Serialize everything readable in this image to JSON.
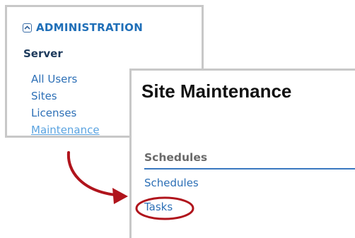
{
  "admin": {
    "title": "ADMINISTRATION",
    "section": "Server",
    "links": [
      {
        "label": "All Users"
      },
      {
        "label": "Sites"
      },
      {
        "label": "Licenses"
      },
      {
        "label": "Maintenance"
      }
    ],
    "active_link": "Maintenance"
  },
  "site": {
    "title": "Site Maintenance",
    "section_heading": "Schedules",
    "links": [
      {
        "label": "Schedules"
      },
      {
        "label": "Tasks"
      }
    ],
    "highlighted_link": "Tasks"
  },
  "annotation": {
    "arrow_icon": "curved-arrow-icon",
    "highlight_icon": "circle-highlight-icon",
    "color": "#b0141c"
  },
  "colors": {
    "link": "#2c6fb6",
    "active_link": "#5aa3e0",
    "accent": "#1f6fb8",
    "rule": "#3a78c0"
  }
}
